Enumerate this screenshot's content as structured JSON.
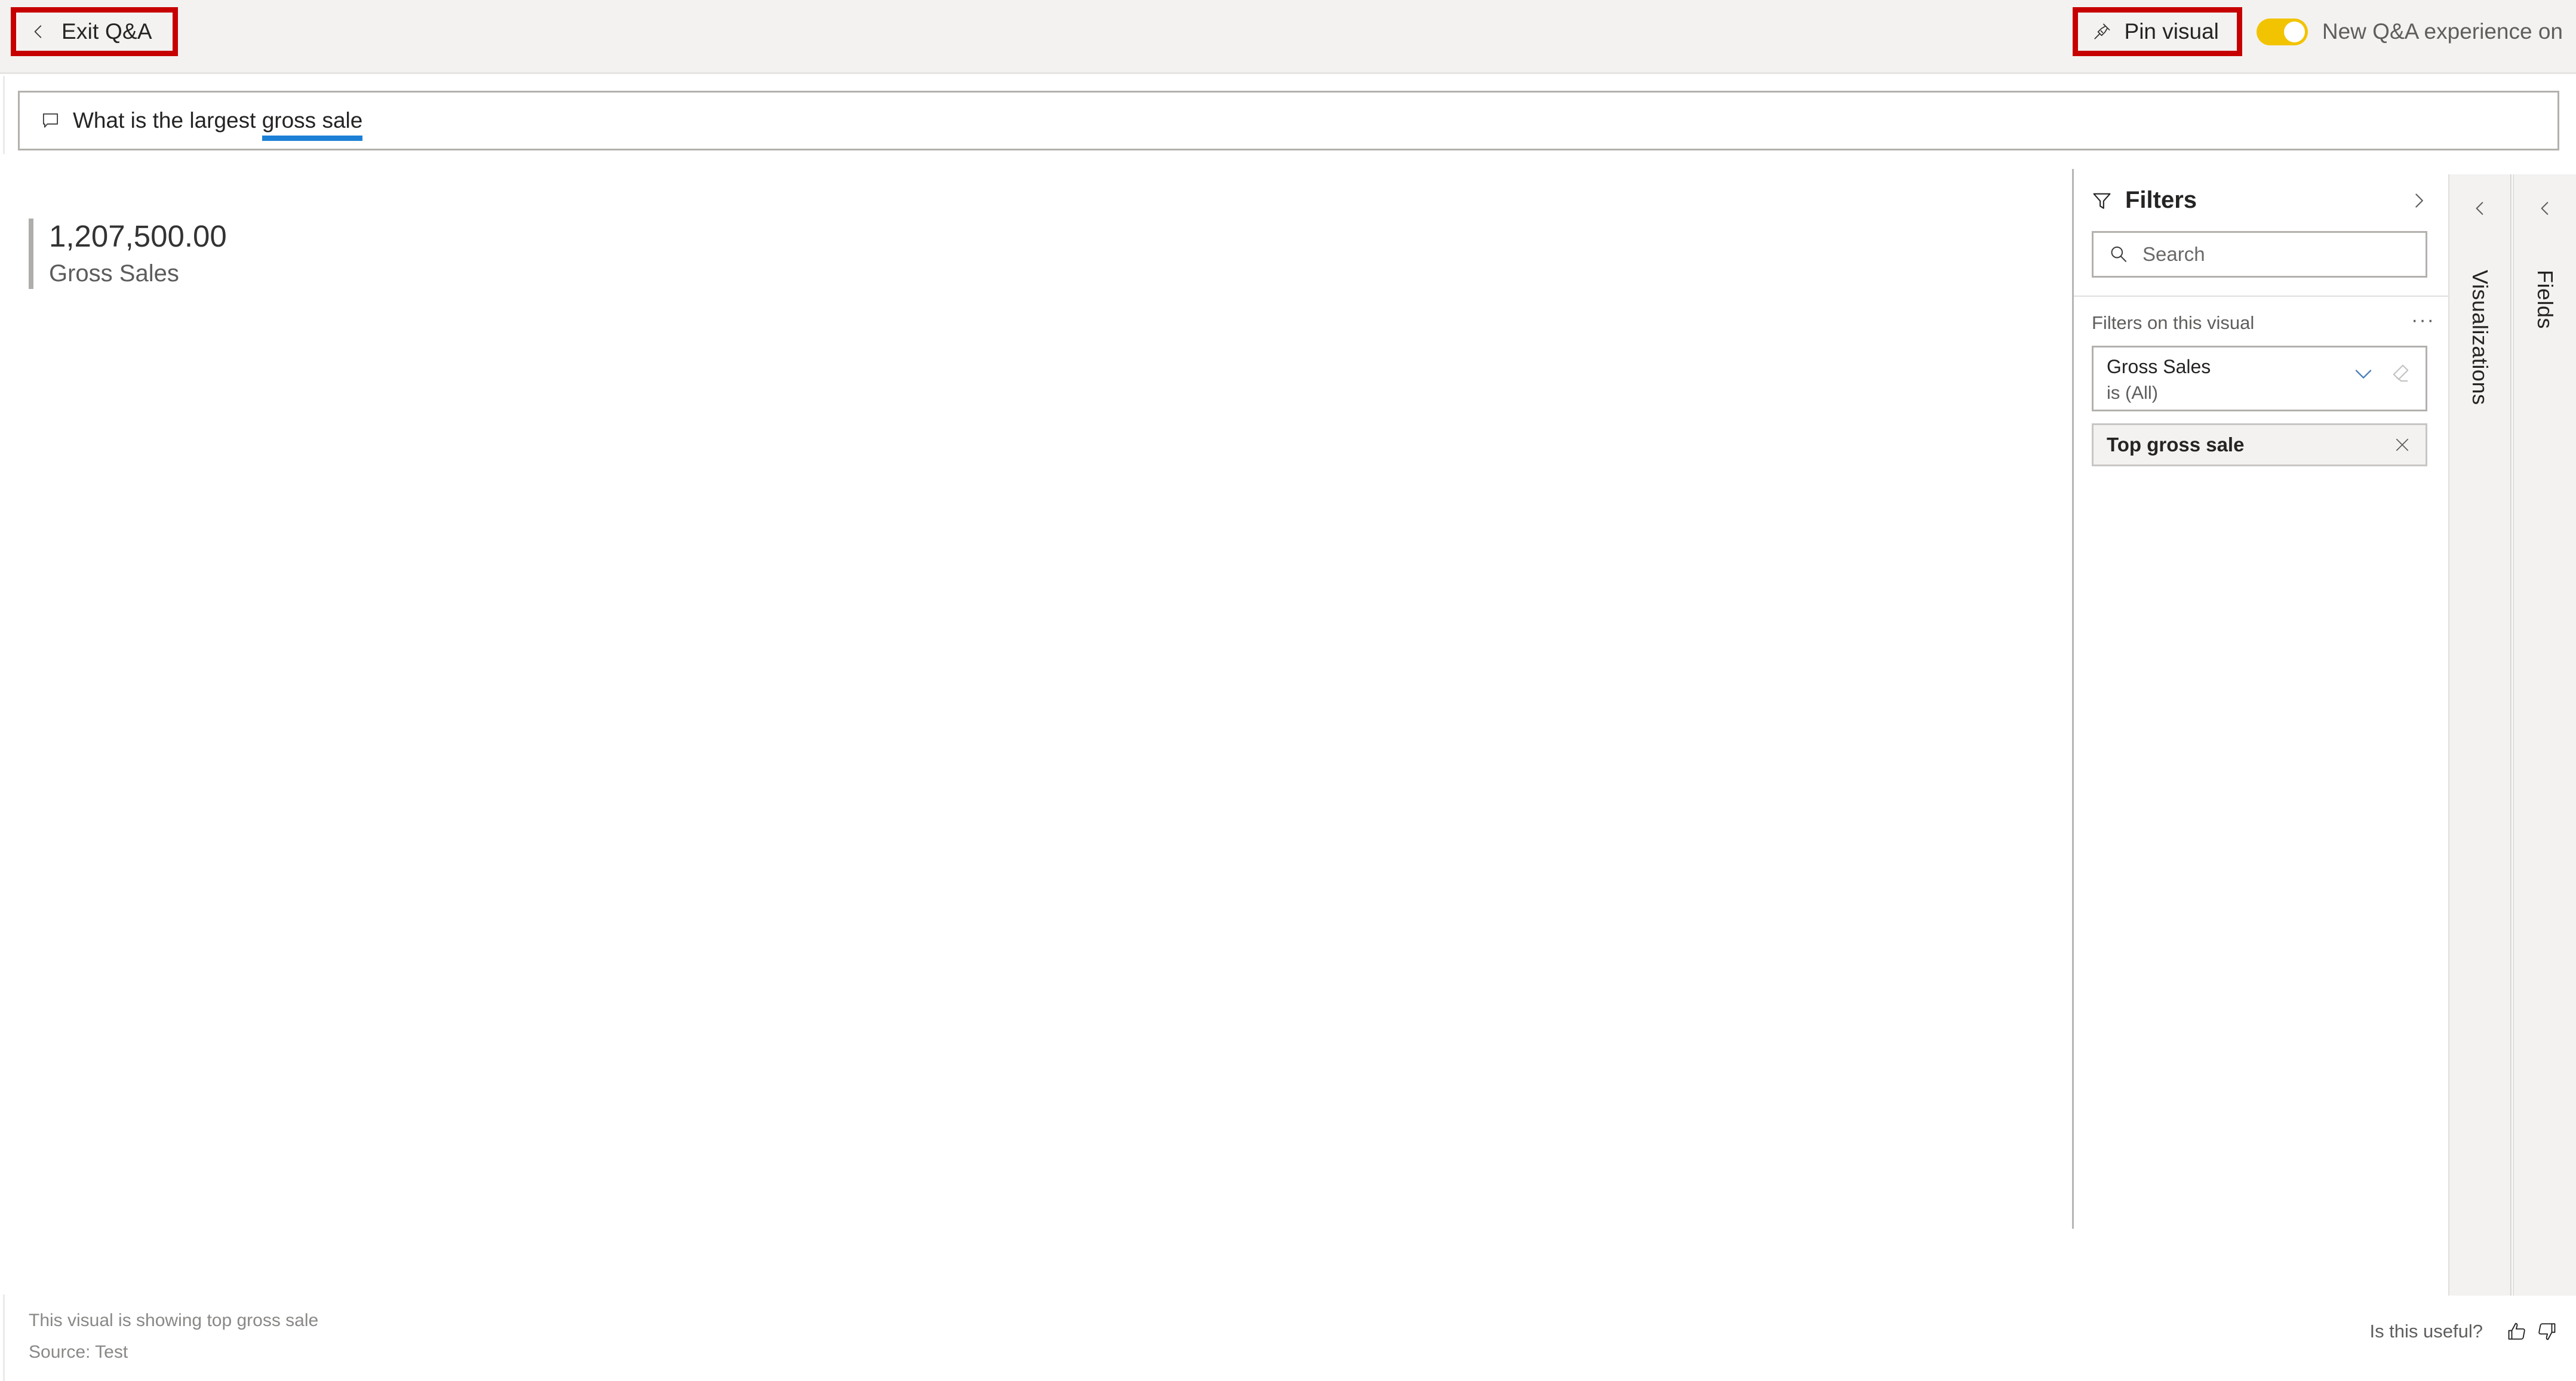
{
  "topbar": {
    "exit_label": "Exit Q&A",
    "exit_icon": "chevron-left-icon",
    "pin_label": "Pin visual",
    "pin_icon": "pin-icon",
    "toggle_label": "New Q&A experience on",
    "toggle_state": "on",
    "toggle_color": "#F2C300",
    "annotation_color": "#C60000"
  },
  "question": {
    "icon": "comment-bubble-icon",
    "prefix": "What is the largest ",
    "entity": "gross sale",
    "entity_underline_color": "#1C7FD6",
    "full_text": "What is the largest gross sale"
  },
  "visual": {
    "value": "1,207,500.00",
    "label": "Gross Sales",
    "accent_color": "#B0AEAC"
  },
  "footer": {
    "line1": "This visual is showing top gross sale",
    "line2": "Source: Test"
  },
  "feedback": {
    "label": "Is this useful?",
    "thumbs_up_icon": "thumbs-up-icon",
    "thumbs_down_icon": "thumbs-down-icon"
  },
  "filters": {
    "title": "Filters",
    "title_icon": "funnel-icon",
    "collapse_icon": "chevron-right-icon",
    "search_placeholder": "Search",
    "search_icon": "search-icon",
    "section_title": "Filters on this visual",
    "more_label": "···",
    "cards": [
      {
        "field": "Gross Sales",
        "condition": "is (All)",
        "expand_icon": "chevron-down-icon",
        "clear_icon": "eraser-icon"
      }
    ],
    "chips": [
      {
        "label": "Top gross sale",
        "remove_icon": "close-icon"
      }
    ]
  },
  "side_panes": [
    {
      "title": "Visualizations",
      "expand_icon": "chevron-left-icon"
    },
    {
      "title": "Fields",
      "expand_icon": "chevron-left-icon"
    }
  ]
}
